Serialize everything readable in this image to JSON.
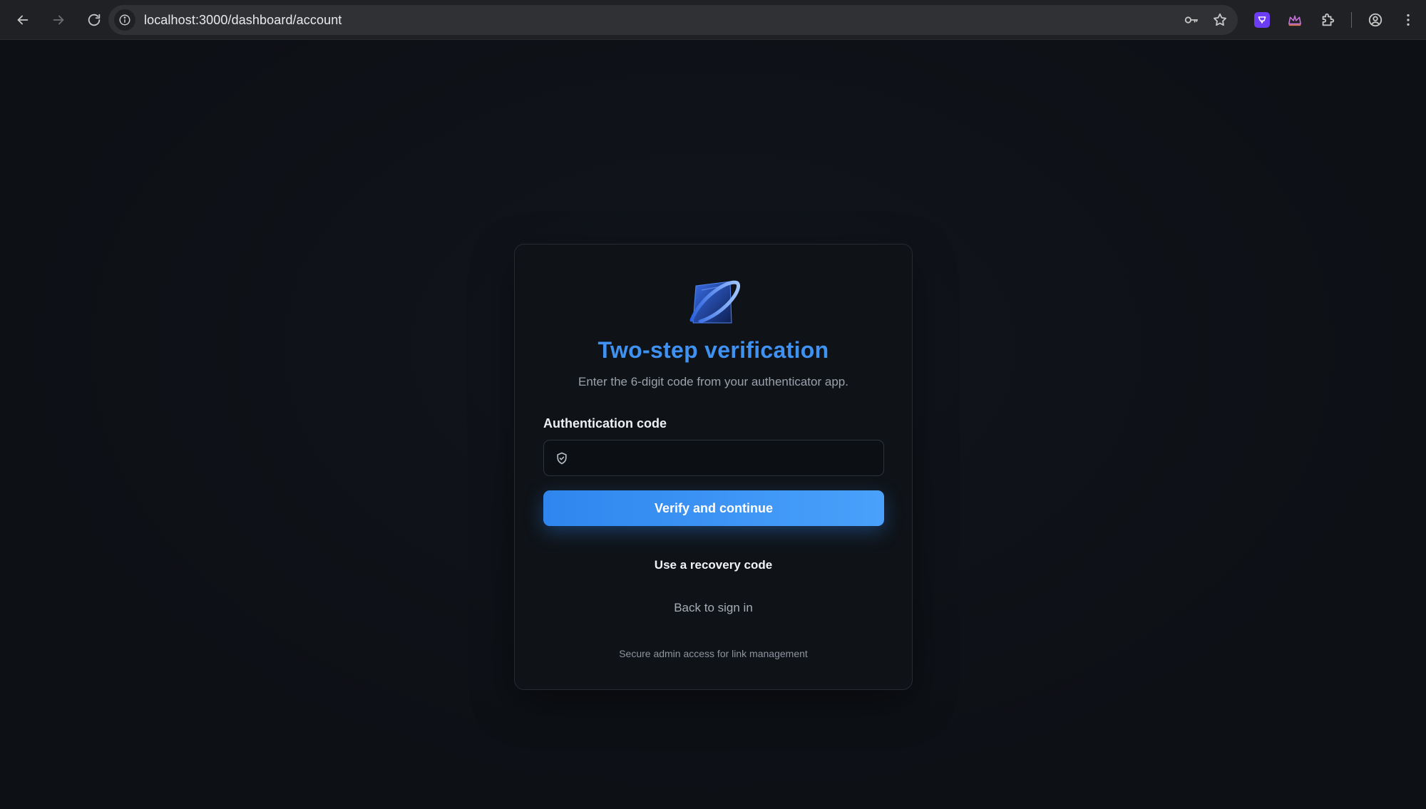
{
  "browser": {
    "url": "localhost:3000/dashboard/account",
    "icons": [
      "back-arrow-icon",
      "forward-arrow-icon",
      "reload-icon",
      "site-info-icon",
      "password-key-icon",
      "bookmark-star-icon",
      "extension-purple-icon",
      "extension-crown-icon",
      "extensions-puzzle-icon",
      "profile-icon",
      "menu-kebab-icon"
    ]
  },
  "card": {
    "logo_icon": "app-logo-icon",
    "title": "Two-step verification",
    "subtitle": "Enter the 6-digit code from your authenticator app.",
    "field_label": "Authentication code",
    "input_icon": "shield-check-icon",
    "input_value": "",
    "input_placeholder": "",
    "primary_button": "Verify and continue",
    "recovery_link": "Use a recovery code",
    "back_link": "Back to sign in",
    "footer_note": "Secure admin access for link management"
  },
  "colors": {
    "accent": "#3f92f2",
    "button_gradient_start": "#2f86ee",
    "button_gradient_end": "#4aa1fb",
    "page_background": "#0e1116",
    "card_background": "#0f1318"
  }
}
